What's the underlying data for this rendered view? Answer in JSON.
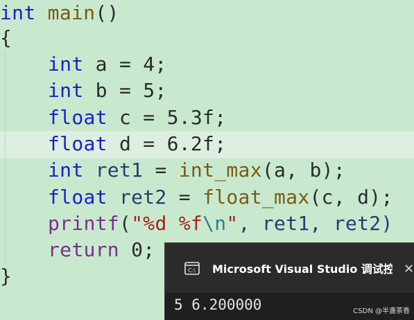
{
  "code": {
    "line1": {
      "kw": "int",
      "fn": "main",
      "rest": "()"
    },
    "line2": {
      "text": "{"
    },
    "line3": {
      "kw": "int",
      "rest": " a = 4;"
    },
    "line4": {
      "kw": "int",
      "rest": " b = 5;"
    },
    "line5": {
      "kw": "float",
      "rest": " c = 5.3f;"
    },
    "line6": {
      "kw": "float",
      "rest": " d = 6.2f;"
    },
    "line7": {
      "kw": "int",
      "var": " ret1",
      "mid": " = ",
      "fn": "int_max",
      "rest": "(a, b);"
    },
    "line8": {
      "kw": "float",
      "var": " ret2",
      "mid": " = ",
      "fn": "float_max",
      "rest": "(c, d);"
    },
    "line9": {
      "fn": "printf",
      "open": "(",
      "str1": "\"%d %f",
      "esc": "\\n",
      "str2": "\"",
      "rest": ", ret1, ret2)"
    },
    "line10": {
      "kw": "return",
      "rest": " 0;"
    },
    "line11": {
      "text": "}"
    }
  },
  "console": {
    "title": "Microsoft Visual Studio 调试控",
    "close_glyph": "✕",
    "output": "5 6.200000"
  },
  "watermark": "CSDN @半盏茶香",
  "colors": {
    "editor_background": "#c9e9cf",
    "keyword": "#1e1ec8",
    "console_background": "#1f1f1f"
  },
  "icons": [
    "console-app-icon",
    "close-icon"
  ]
}
